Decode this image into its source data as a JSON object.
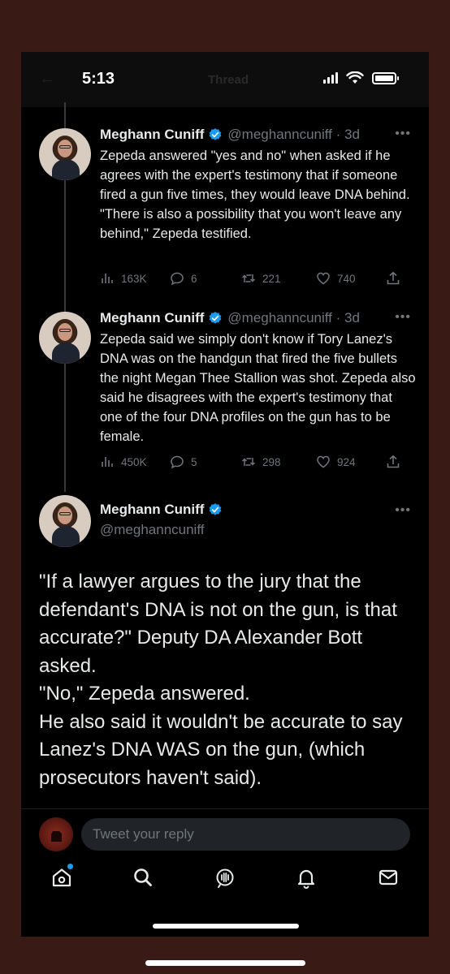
{
  "status_bar": {
    "time": "5:13",
    "ghost_title": "Thread"
  },
  "tweets": [
    {
      "name": "Meghann Cuniff",
      "handle": "@meghanncuniff",
      "time": "3d",
      "text": "Zepeda answered \"yes and no\" when asked if he agrees with the expert's testimony that if someone fired a gun five times, they would leave DNA behind.\n\"There is also a possibility that you won't leave any behind,\" Zepeda testified.",
      "views": "163K",
      "replies": "6",
      "retweets": "221",
      "likes": "740"
    },
    {
      "name": "Meghann Cuniff",
      "handle": "@meghanncuniff",
      "time": "3d",
      "text": "Zepeda said we simply don't know if Tory Lanez's DNA was on the handgun that fired the five bullets the night Megan Thee Stallion was shot. Zepeda also said he disagrees with the expert's testimony that one of the four DNA profiles on the gun has to be female.",
      "views": "450K",
      "replies": "5",
      "retweets": "298",
      "likes": "924"
    }
  ],
  "main_tweet": {
    "name": "Meghann Cuniff",
    "handle": "@meghanncuniff",
    "text": "\"If a lawyer argues to the jury that the defendant's DNA is not on the gun, is that accurate?\" Deputy DA Alexander Bott asked.\n\"No,\" Zepeda answered.\nHe also said it wouldn't be accurate to say Lanez's DNA WAS on the gun, (which prosecutors haven't said)."
  },
  "reply": {
    "placeholder": "Tweet your reply"
  },
  "colors": {
    "accent": "#1d9bf0",
    "background": "#000000",
    "muted": "#71767b",
    "text": "#e7e9ea"
  },
  "tabs": [
    "home-icon",
    "search-icon",
    "spaces-icon",
    "notifications-icon",
    "messages-icon"
  ]
}
